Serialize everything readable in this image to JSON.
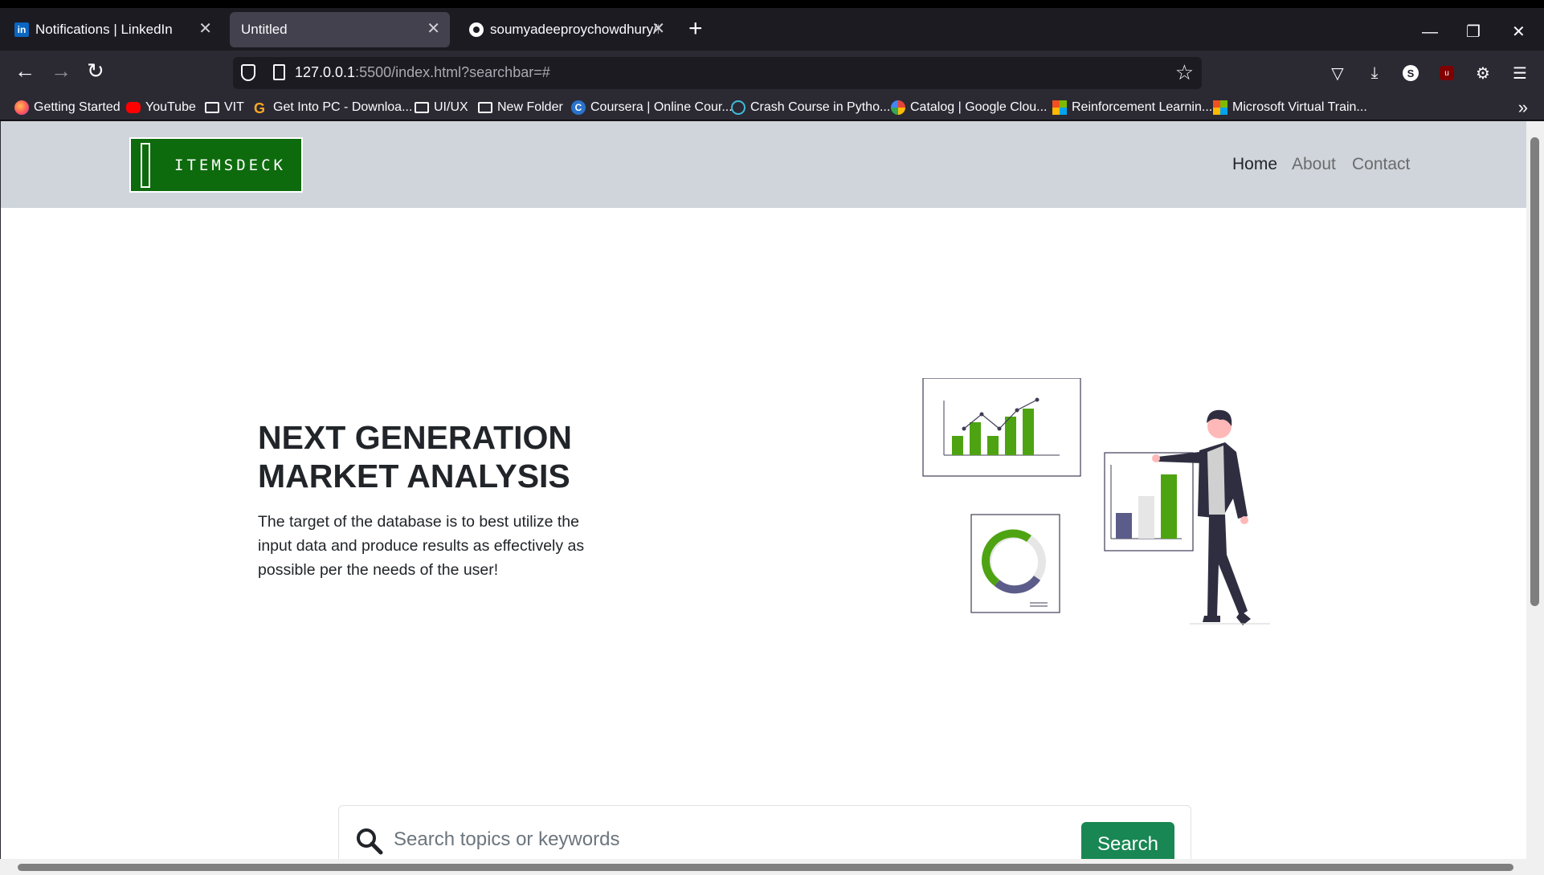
{
  "tabs": [
    {
      "title": "Notifications | LinkedIn",
      "icon": "linkedin-icon",
      "active": false
    },
    {
      "title": "Untitled",
      "icon": "",
      "active": true
    },
    {
      "title": "soumyadeeproychowdhury/Item",
      "icon": "github-icon",
      "active": false
    }
  ],
  "urlbar": {
    "host": "127.0.0.1",
    "path": ":5500/index.html?searchbar=#"
  },
  "bookmarks": [
    {
      "label": "Getting Started",
      "icon": "firefox-icon"
    },
    {
      "label": "YouTube",
      "icon": "youtube-icon"
    },
    {
      "label": "VIT",
      "icon": "folder-icon"
    },
    {
      "label": "Get Into PC - Downloa...",
      "icon": "getintopc-icon"
    },
    {
      "label": "UI/UX",
      "icon": "folder-icon"
    },
    {
      "label": "New Folder",
      "icon": "folder-icon"
    },
    {
      "label": "Coursera | Online Cour...",
      "icon": "coursera-icon"
    },
    {
      "label": "Crash Course in Pytho...",
      "icon": "python-icon"
    },
    {
      "label": "Catalog | Google Clou...",
      "icon": "google-cloud-icon"
    },
    {
      "label": "Reinforcement Learnin...",
      "icon": "microsoft-icon"
    },
    {
      "label": "Microsoft Virtual Train...",
      "icon": "microsoft-icon"
    }
  ],
  "site": {
    "logo_text": "ITEMSDECK",
    "nav": [
      "Home",
      "About",
      "Contact"
    ],
    "hero_title_line1": "NEXT GENERATION",
    "hero_title_line2": "MARKET ANALYSIS",
    "hero_desc": "The target of the database is to best utilize the input data and produce results as effectively as possible per the needs of the user!",
    "search_placeholder": "Search topics or keywords",
    "search_button": "Search"
  },
  "colors": {
    "brand_green": "#0d6b0d",
    "button_green": "#198754",
    "chart_green": "#4ea312",
    "chart_purple": "#5c5c8a"
  }
}
